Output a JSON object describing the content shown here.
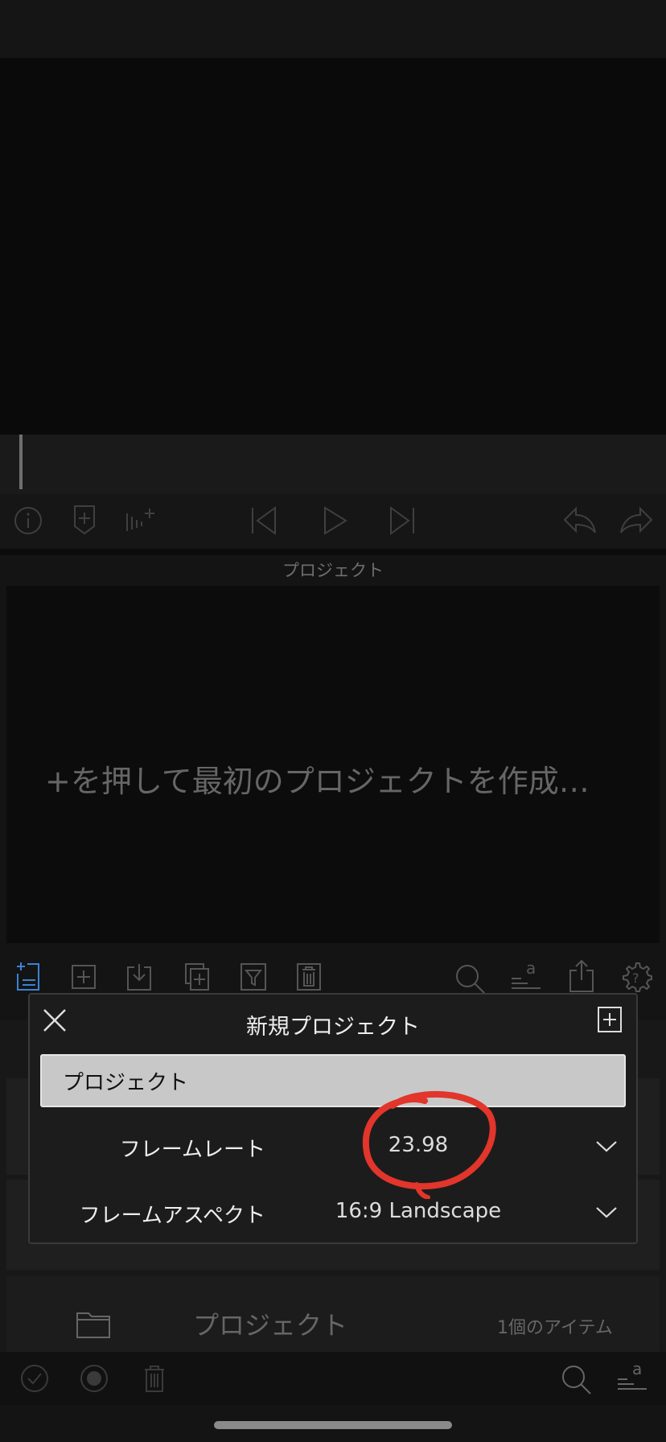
{
  "browser": {
    "title": "プロジェクト",
    "empty_message": "+を押して最初のプロジェクトを作成…"
  },
  "modal": {
    "title": "新規プロジェクト",
    "project_name": "プロジェクト",
    "rows": [
      {
        "label": "フレームレート",
        "value": "23.98"
      },
      {
        "label": "フレームアスペクト",
        "value": "16:9  Landscape"
      }
    ]
  },
  "list": {
    "folder_name": "プロジェクト",
    "item_count": "1個のアイテム"
  },
  "colors": {
    "accent": "#3b82d6",
    "annotation": "#e2352b"
  },
  "icons": [
    "info-icon",
    "marker-icon",
    "voiceover-icon",
    "skip-back-icon",
    "play-icon",
    "skip-forward-icon",
    "undo-icon",
    "redo-icon",
    "new-project-icon",
    "add-icon",
    "import-icon",
    "duplicate-icon",
    "filter-icon",
    "trash-icon",
    "search-icon",
    "sort-icon",
    "share-icon",
    "gear-icon",
    "close-icon",
    "folder-icon",
    "checkmark-icon",
    "record-icon"
  ]
}
